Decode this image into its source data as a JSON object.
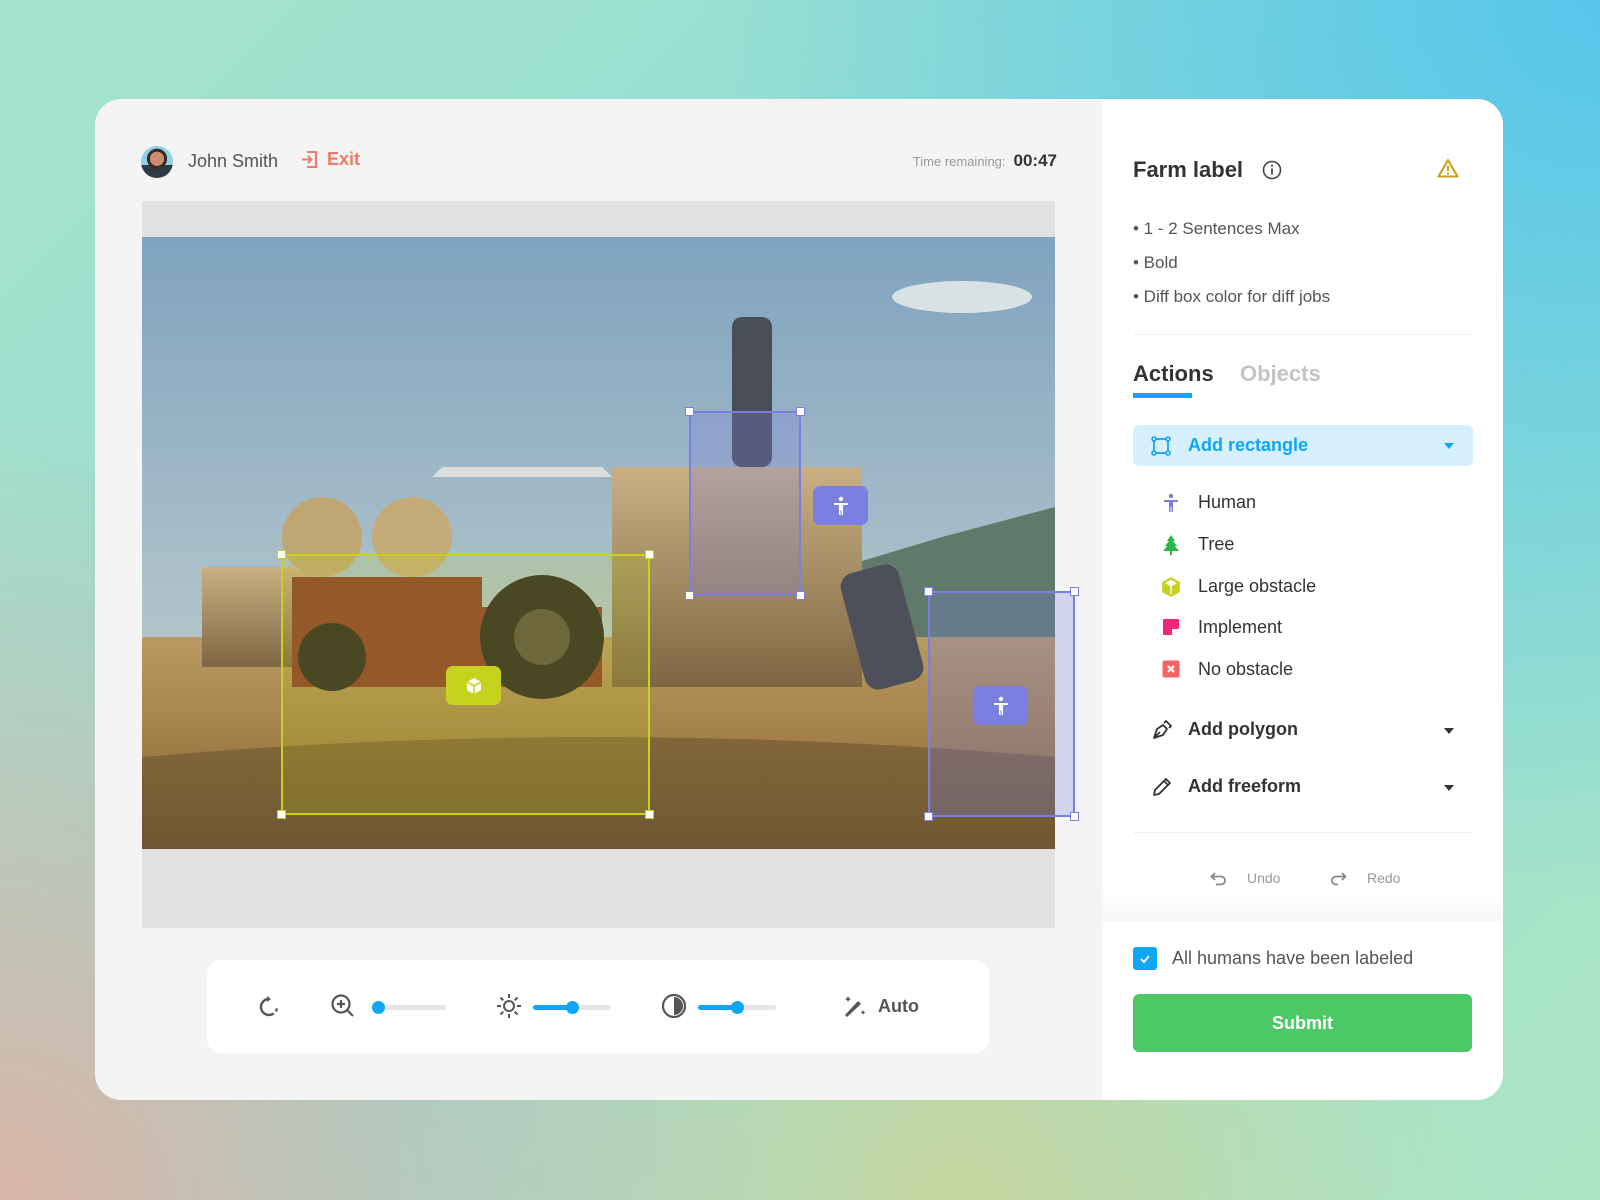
{
  "header": {
    "user_name": "John Smith",
    "exit_label": "Exit",
    "time_label": "Time remaining:",
    "time_value": "00:47"
  },
  "panel": {
    "title": "Farm label",
    "instructions": [
      "• 1 - 2 Sentences Max",
      "• Bold",
      "• Diff box color for diff jobs"
    ],
    "tabs": [
      {
        "label": "Actions",
        "active": true
      },
      {
        "label": "Objects",
        "active": false
      }
    ],
    "add_rectangle": "Add rectangle",
    "objects": [
      {
        "label": "Human",
        "icon": "human-icon",
        "color": "#7b7fe0"
      },
      {
        "label": "Tree",
        "icon": "tree-icon",
        "color": "#2bb84a"
      },
      {
        "label": "Large obstacle",
        "icon": "cube-icon",
        "color": "#c6d21e"
      },
      {
        "label": "Implement",
        "icon": "note-icon",
        "color": "#f0277a"
      },
      {
        "label": "No obstacle",
        "icon": "x-box-icon",
        "color": "#f56565"
      }
    ],
    "add_polygon": "Add polygon",
    "add_freeform": "Add freeform",
    "undo": "Undo",
    "redo": "Redo",
    "checkbox_label": "All humans have been labeled",
    "checkbox_checked": true,
    "submit": "Submit"
  },
  "toolbar": {
    "auto_label": "Auto",
    "zoom_level": 0,
    "brightness": 0.5,
    "contrast": 0.5
  },
  "colors": {
    "accent": "#10a6f5",
    "submit": "#4cc966",
    "human": "#7b7fe0",
    "obstacle": "#c6d21e",
    "exit": "#f07a62",
    "warning": "#c9a21a"
  }
}
